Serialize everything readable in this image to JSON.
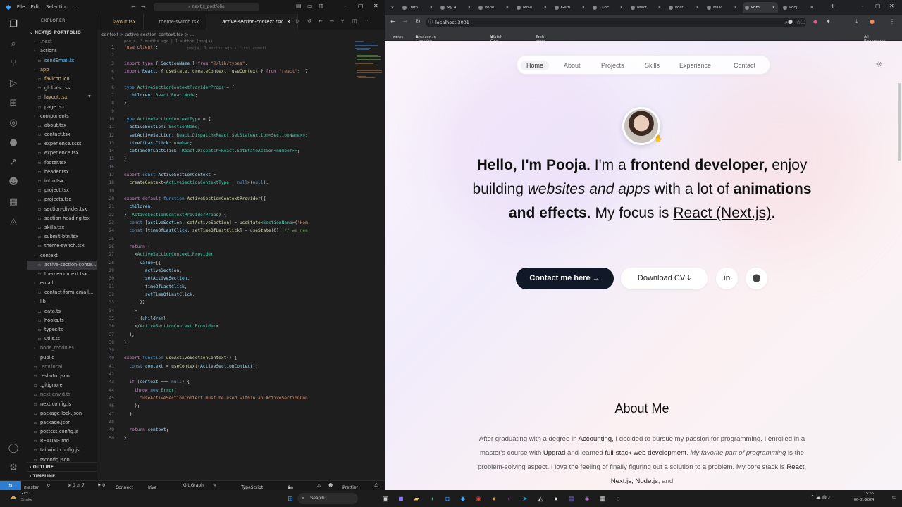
{
  "vscode": {
    "menu": [
      "File",
      "Edit",
      "Selection",
      "..."
    ],
    "title": "nextjs_portfolio",
    "explorer_title": "EXPLORER",
    "project": "NEXTJS_PORTFOLIO",
    "tree": [
      {
        "name": ".next",
        "indent": 1,
        "type": "folder",
        "color": "#888"
      },
      {
        "name": "actions",
        "indent": 1,
        "type": "folder",
        "color": "#ccc"
      },
      {
        "name": "sendEmail.ts",
        "indent": 2,
        "type": "file",
        "color": "#4fc1ff"
      },
      {
        "name": "app",
        "indent": 1,
        "type": "folder",
        "color": "#e2c08d"
      },
      {
        "name": "favicon.ico",
        "indent": 2,
        "type": "file",
        "color": "#e2c08d"
      },
      {
        "name": "globals.css",
        "indent": 2,
        "type": "file",
        "color": "#ccc"
      },
      {
        "name": "layout.tsx",
        "indent": 2,
        "type": "file",
        "color": "#e2c08d",
        "badge": "7"
      },
      {
        "name": "page.tsx",
        "indent": 2,
        "type": "file",
        "color": "#ccc"
      },
      {
        "name": "components",
        "indent": 1,
        "type": "folder",
        "color": "#ccc"
      },
      {
        "name": "about.tsx",
        "indent": 2,
        "type": "file",
        "color": "#ccc"
      },
      {
        "name": "contact.tsx",
        "indent": 2,
        "type": "file",
        "color": "#ccc"
      },
      {
        "name": "experience.scss",
        "indent": 2,
        "type": "file",
        "color": "#ccc"
      },
      {
        "name": "experience.tsx",
        "indent": 2,
        "type": "file",
        "color": "#ccc"
      },
      {
        "name": "footer.tsx",
        "indent": 2,
        "type": "file",
        "color": "#ccc"
      },
      {
        "name": "header.tsx",
        "indent": 2,
        "type": "file",
        "color": "#ccc"
      },
      {
        "name": "intro.tsx",
        "indent": 2,
        "type": "file",
        "color": "#ccc"
      },
      {
        "name": "project.tsx",
        "indent": 2,
        "type": "file",
        "color": "#ccc"
      },
      {
        "name": "projects.tsx",
        "indent": 2,
        "type": "file",
        "color": "#ccc"
      },
      {
        "name": "section-divider.tsx",
        "indent": 2,
        "type": "file",
        "color": "#ccc"
      },
      {
        "name": "section-heading.tsx",
        "indent": 2,
        "type": "file",
        "color": "#ccc"
      },
      {
        "name": "skills.tsx",
        "indent": 2,
        "type": "file",
        "color": "#ccc"
      },
      {
        "name": "submit-btn.tsx",
        "indent": 2,
        "type": "file",
        "color": "#ccc"
      },
      {
        "name": "theme-switch.tsx",
        "indent": 2,
        "type": "file",
        "color": "#ccc"
      },
      {
        "name": "context",
        "indent": 1,
        "type": "folder",
        "color": "#ccc"
      },
      {
        "name": "active-section-conte...",
        "indent": 2,
        "type": "file",
        "color": "#ccc",
        "selected": true
      },
      {
        "name": "theme-context.tsx",
        "indent": 2,
        "type": "file",
        "color": "#ccc"
      },
      {
        "name": "email",
        "indent": 1,
        "type": "folder",
        "color": "#ccc"
      },
      {
        "name": "contact-form-email....",
        "indent": 2,
        "type": "file",
        "color": "#ccc"
      },
      {
        "name": "lib",
        "indent": 1,
        "type": "folder",
        "color": "#ccc"
      },
      {
        "name": "data.ts",
        "indent": 2,
        "type": "file",
        "color": "#ccc"
      },
      {
        "name": "hooks.ts",
        "indent": 2,
        "type": "file",
        "color": "#ccc"
      },
      {
        "name": "types.ts",
        "indent": 2,
        "type": "file",
        "color": "#ccc"
      },
      {
        "name": "utils.ts",
        "indent": 2,
        "type": "file",
        "color": "#ccc"
      },
      {
        "name": "node_modules",
        "indent": 1,
        "type": "folder",
        "color": "#888"
      },
      {
        "name": "public",
        "indent": 1,
        "type": "folder",
        "color": "#ccc"
      },
      {
        "name": ".env.local",
        "indent": 1,
        "type": "file",
        "color": "#888"
      },
      {
        "name": ".eslintrc.json",
        "indent": 1,
        "type": "file",
        "color": "#ccc"
      },
      {
        "name": ".gitignore",
        "indent": 1,
        "type": "file",
        "color": "#ccc"
      },
      {
        "name": "next-env.d.ts",
        "indent": 1,
        "type": "file",
        "color": "#888"
      },
      {
        "name": "next.config.js",
        "indent": 1,
        "type": "file",
        "color": "#ccc"
      },
      {
        "name": "package-lock.json",
        "indent": 1,
        "type": "file",
        "color": "#ccc"
      },
      {
        "name": "package.json",
        "indent": 1,
        "type": "file",
        "color": "#ccc"
      },
      {
        "name": "postcss.config.js",
        "indent": 1,
        "type": "file",
        "color": "#ccc"
      },
      {
        "name": "README.md",
        "indent": 1,
        "type": "file",
        "color": "#ccc"
      },
      {
        "name": "tailwind.config.js",
        "indent": 1,
        "type": "file",
        "color": "#ccc"
      },
      {
        "name": "tsconfig.json",
        "indent": 1,
        "type": "file",
        "color": "#ccc"
      }
    ],
    "outline": "OUTLINE",
    "timeline": "TIMELINE",
    "tabs": [
      {
        "label": "layout.tsx",
        "active": false
      },
      {
        "label": "theme-switch.tsx",
        "active": false
      },
      {
        "label": "active-section-context.tsx",
        "active": true
      }
    ],
    "breadcrumb": "context > active-section-context.tsx > ...",
    "blame": "pooja, 3 months ago | 1 author (pooja)",
    "inline_blame": "pooja, 3 months ago • first commit",
    "code": [
      [
        [
          "s",
          "\"use client\""
        ],
        [
          "",
          "; "
        ]
      ],
      [],
      [
        [
          "kw",
          "import"
        ],
        [
          "",
          " "
        ],
        [
          "kw",
          "type"
        ],
        [
          "",
          " { "
        ],
        [
          "v",
          "SectionName"
        ],
        [
          "",
          " } "
        ],
        [
          "kw",
          "from"
        ],
        [
          "",
          " "
        ],
        [
          "s",
          "\"@/lib/types\""
        ],
        [
          "",
          ";"
        ]
      ],
      [
        [
          "kw",
          "import"
        ],
        [
          "",
          " "
        ],
        [
          "v",
          "React"
        ],
        [
          "",
          ", { "
        ],
        [
          "f",
          "useState"
        ],
        [
          "",
          ", "
        ],
        [
          "f",
          "createContext"
        ],
        [
          "",
          ", "
        ],
        [
          "f",
          "useContext"
        ],
        [
          "",
          " } "
        ],
        [
          "kw",
          "from"
        ],
        [
          "",
          " "
        ],
        [
          "s",
          "\"react\""
        ],
        [
          "",
          ";  7"
        ]
      ],
      [],
      [
        [
          "k",
          "type"
        ],
        [
          "",
          " "
        ],
        [
          "t",
          "ActiveSectionContextProviderProps"
        ],
        [
          "",
          " = {"
        ]
      ],
      [
        [
          "",
          "  "
        ],
        [
          "v",
          "children"
        ],
        [
          "",
          ": "
        ],
        [
          "t",
          "React.ReactNode"
        ],
        [
          "",
          ";"
        ]
      ],
      [
        [
          "",
          "};"
        ]
      ],
      [],
      [
        [
          "k",
          "type"
        ],
        [
          "",
          " "
        ],
        [
          "t",
          "ActiveSectionContextType"
        ],
        [
          "",
          " = {"
        ]
      ],
      [
        [
          "",
          "  "
        ],
        [
          "v",
          "activeSection"
        ],
        [
          "",
          ": "
        ],
        [
          "t",
          "SectionName"
        ],
        [
          "",
          ";"
        ]
      ],
      [
        [
          "",
          "  "
        ],
        [
          "v",
          "setActiveSection"
        ],
        [
          "",
          ": "
        ],
        [
          "t",
          "React.Dispatch<React.SetStateAction<SectionName>>"
        ],
        [
          "",
          ";"
        ]
      ],
      [
        [
          "",
          "  "
        ],
        [
          "v",
          "timeOfLastClick"
        ],
        [
          "",
          ": "
        ],
        [
          "t",
          "number"
        ],
        [
          "",
          ";"
        ]
      ],
      [
        [
          "",
          "  "
        ],
        [
          "v",
          "setTimeOfLastClick"
        ],
        [
          "",
          ": "
        ],
        [
          "t",
          "React.Dispatch<React.SetStateAction<number>>"
        ],
        [
          "",
          ";"
        ]
      ],
      [
        [
          "",
          "};"
        ]
      ],
      [],
      [
        [
          "kw",
          "export"
        ],
        [
          "",
          " "
        ],
        [
          "k",
          "const"
        ],
        [
          "",
          " "
        ],
        [
          "v",
          "ActiveSectionContext"
        ],
        [
          "",
          " ="
        ]
      ],
      [
        [
          "",
          "  "
        ],
        [
          "f",
          "createContext"
        ],
        [
          "",
          "<"
        ],
        [
          "t",
          "ActiveSectionContextType"
        ],
        [
          "",
          " | "
        ],
        [
          "k",
          "null"
        ],
        [
          "",
          ">("
        ],
        [
          "k",
          "null"
        ],
        [
          "",
          ");"
        ]
      ],
      [],
      [
        [
          "kw",
          "export"
        ],
        [
          "",
          " "
        ],
        [
          "kw",
          "default"
        ],
        [
          "",
          " "
        ],
        [
          "k",
          "function"
        ],
        [
          "",
          " "
        ],
        [
          "f",
          "ActiveSectionContextProvider"
        ],
        [
          "",
          "({"
        ]
      ],
      [
        [
          "",
          "  "
        ],
        [
          "v",
          "children"
        ],
        [
          "",
          ","
        ]
      ],
      [
        [
          "",
          "}: "
        ],
        [
          "t",
          "ActiveSectionContextProviderProps"
        ],
        [
          "",
          ") {"
        ]
      ],
      [
        [
          "",
          "  "
        ],
        [
          "k",
          "const"
        ],
        [
          "",
          " ["
        ],
        [
          "v",
          "activeSection"
        ],
        [
          "",
          ", "
        ],
        [
          "f",
          "setActiveSection"
        ],
        [
          "",
          "] = "
        ],
        [
          "f",
          "useState"
        ],
        [
          "",
          "<"
        ],
        [
          "t",
          "SectionName"
        ],
        [
          "",
          ">("
        ],
        [
          "s",
          "\"Hom"
        ]
      ],
      [
        [
          "",
          "  "
        ],
        [
          "k",
          "const"
        ],
        [
          "",
          " ["
        ],
        [
          "v",
          "timeOfLastClick"
        ],
        [
          "",
          ", "
        ],
        [
          "f",
          "setTimeOfLastClick"
        ],
        [
          "",
          "] = "
        ],
        [
          "f",
          "useState"
        ],
        [
          "",
          "(0); "
        ],
        [
          "c",
          "// we nee"
        ]
      ],
      [],
      [
        [
          "",
          "  "
        ],
        [
          "kw",
          "return"
        ],
        [
          "",
          " ("
        ]
      ],
      [
        [
          "",
          "    <"
        ],
        [
          "t",
          "ActiveSectionContext.Provider"
        ]
      ],
      [
        [
          "",
          "      "
        ],
        [
          "v",
          "value"
        ],
        [
          "",
          "={{"
        ]
      ],
      [
        [
          "",
          "        "
        ],
        [
          "v",
          "activeSection"
        ],
        [
          "",
          ","
        ]
      ],
      [
        [
          "",
          "        "
        ],
        [
          "v",
          "setActiveSection"
        ],
        [
          "",
          ","
        ]
      ],
      [
        [
          "",
          "        "
        ],
        [
          "v",
          "timeOfLastClick"
        ],
        [
          "",
          ","
        ]
      ],
      [
        [
          "",
          "        "
        ],
        [
          "v",
          "setTimeOfLastClick"
        ],
        [
          "",
          ","
        ]
      ],
      [
        [
          "",
          "      }}"
        ]
      ],
      [
        [
          "",
          "    >"
        ]
      ],
      [
        [
          "",
          "      {"
        ],
        [
          "v",
          "children"
        ],
        [
          "",
          "}"
        ]
      ],
      [
        [
          "",
          "    </"
        ],
        [
          "t",
          "ActiveSectionContext.Provider"
        ],
        [
          "",
          ">"
        ]
      ],
      [
        [
          "",
          "  );"
        ]
      ],
      [
        [
          "",
          "}"
        ]
      ],
      [],
      [
        [
          "kw",
          "export"
        ],
        [
          "",
          " "
        ],
        [
          "k",
          "function"
        ],
        [
          "",
          " "
        ],
        [
          "f",
          "useActiveSectionContext"
        ],
        [
          "",
          "() {"
        ]
      ],
      [
        [
          "",
          "  "
        ],
        [
          "k",
          "const"
        ],
        [
          "",
          " "
        ],
        [
          "v",
          "context"
        ],
        [
          "",
          " = "
        ],
        [
          "f",
          "useContext"
        ],
        [
          "",
          "("
        ],
        [
          "v",
          "ActiveSectionContext"
        ],
        [
          "",
          ");"
        ]
      ],
      [],
      [
        [
          "",
          "  "
        ],
        [
          "kw",
          "if"
        ],
        [
          "",
          " ("
        ],
        [
          "v",
          "context"
        ],
        [
          "",
          " === "
        ],
        [
          "k",
          "null"
        ],
        [
          "",
          ") {"
        ]
      ],
      [
        [
          "",
          "    "
        ],
        [
          "kw",
          "throw"
        ],
        [
          "",
          " "
        ],
        [
          "k",
          "new"
        ],
        [
          "",
          " "
        ],
        [
          "t",
          "Error"
        ],
        [
          "",
          "("
        ]
      ],
      [
        [
          "",
          "      "
        ],
        [
          "s",
          "\"useActiveSectionContext must be used within an ActiveSectionCon"
        ]
      ],
      [
        [
          "",
          "    );"
        ]
      ],
      [
        [
          "",
          "  }"
        ]
      ],
      [],
      [
        [
          "",
          "  "
        ],
        [
          "kw",
          "return"
        ],
        [
          "",
          " "
        ],
        [
          "v",
          "context"
        ],
        [
          "",
          ";"
        ]
      ],
      [
        [
          "",
          "}"
        ]
      ]
    ],
    "status": {
      "branch": "master",
      "problems": "⊗ 0 ⚠ 7",
      "ports": "⚑ 0",
      "connect": "Connect",
      "live_share": "Live Share",
      "git_graph": "Git Graph",
      "language": "TypeScript JSX",
      "go_live": "Go Live",
      "prettier": "Prettier"
    }
  },
  "chrome": {
    "tabs": [
      "Dam",
      "My A",
      "Popu",
      "Movi",
      "Getti",
      "1XBE",
      "react",
      "Post",
      "MKV",
      "Pom",
      "Pooj"
    ],
    "active_tab_index": 9,
    "url": "localhost:3001",
    "bookmarks": [
      "news",
      "Amazon.in | passbo...",
      "Watch One Piece (D...",
      "Tech news"
    ],
    "all_bookmarks": "All Bookmarks"
  },
  "site": {
    "nav": [
      "Home",
      "About",
      "Projects",
      "Skills",
      "Experience",
      "Contact"
    ],
    "nav_active": "Home",
    "headline": {
      "p1": "Hello, I'm Pooja.",
      "p2": " I'm a ",
      "p3": "frontend developer,",
      "p4": " enjoy building ",
      "p5": "websites and apps",
      "p6": " with a lot of ",
      "p7": "animations and effects",
      "p8": ". My focus is ",
      "p9": "React (Next.js)",
      "p10": "."
    },
    "contact_button": "Contact me here →",
    "cv_button": "Download CV ⤓",
    "linkedin_icon": "in",
    "github_icon": "⬤",
    "about_title": "About Me",
    "about": {
      "a1": "After graduating with a degree in ",
      "a2": "Accounting",
      "a3": ", I decided to pursue my passion for programming. I enrolled in a master's course with ",
      "a4": "Upgrad",
      "a5": " and learned ",
      "a6": "full-stack web development",
      "a7": ". ",
      "a8": "My favorite part of programming",
      "a9": " is the problem-solving aspect. I ",
      "a10": "love",
      "a11": " the feeling of finally figuring out a solution to a problem. My core stack is ",
      "a12": "React, Next.js, Node.js",
      "a13": ", and"
    }
  },
  "taskbar": {
    "weather_temp": "21°C",
    "weather_desc": "Smoke",
    "search": "Search",
    "time": "15:55",
    "date": "06-01-2024"
  }
}
